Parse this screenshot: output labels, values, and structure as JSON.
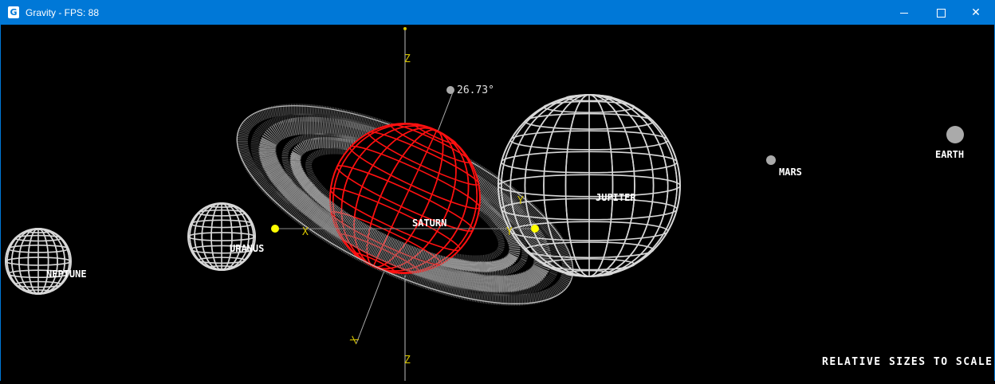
{
  "window": {
    "title": "Gravity - FPS: 88",
    "icon_letter": "G",
    "controls": [
      "minimize-icon",
      "maximize-icon",
      "close-icon"
    ]
  },
  "scene": {
    "planets": {
      "neptune": "NEPTUNE",
      "uranus": "URANUS",
      "saturn": "SATURN",
      "jupiter": "JUPITER",
      "mars": "MARS",
      "earth": "EARTH"
    },
    "axes": {
      "z_top": "Z",
      "z_bottom": "Z",
      "x_left": "X",
      "x_right": "X",
      "y_left": "Y",
      "y_right": "Y"
    },
    "tilt_angle": "26.73°",
    "scale_note": "RELATIVE SIZES TO SCALE",
    "colors": {
      "saturn_wire": "#ff1010",
      "wire": "#d8d8d8",
      "axis_marker": "#ffff00",
      "axis_label": "#d4c200",
      "titlebar": "#0078d7"
    }
  }
}
